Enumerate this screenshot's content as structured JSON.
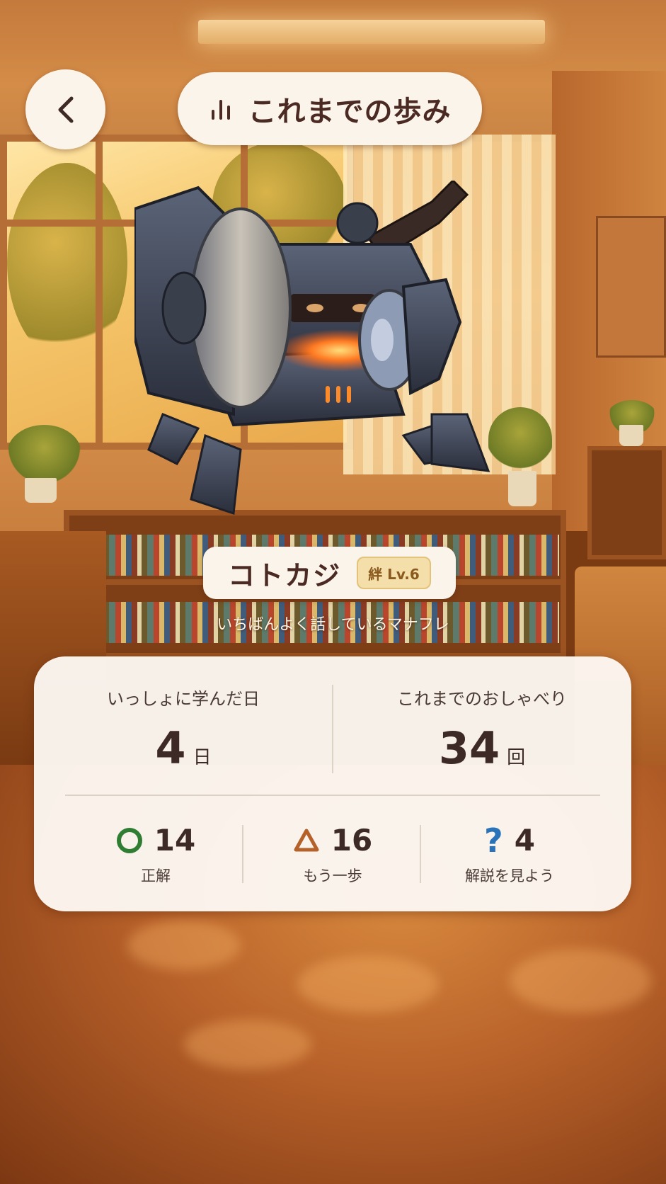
{
  "header": {
    "back_icon": "chevron-left-icon",
    "title_icon": "bar-chart-icon",
    "title": "これまでの歩み"
  },
  "character": {
    "name": "コトカジ",
    "bond_level": "絆 Lv.6",
    "description": "いちばんよく話しているマナフレ"
  },
  "stats": {
    "days_label": "いっしょに学んだ日",
    "days_value": "4",
    "days_unit": "日",
    "chats_label": "これまでのおしゃべり",
    "chats_value": "34",
    "chats_unit": "回",
    "results": [
      {
        "icon": "circle-icon",
        "value": "14",
        "label": "正解",
        "color": "#2e7d32"
      },
      {
        "icon": "triangle-icon",
        "value": "16",
        "label": "もう一歩",
        "color": "#b5622a"
      },
      {
        "icon": "question-icon",
        "value": "4",
        "label": "解説を見よう",
        "color": "#2a73b8"
      }
    ]
  },
  "colors": {
    "panel": "#fbf4ea",
    "text_dark": "#3d2a27"
  }
}
